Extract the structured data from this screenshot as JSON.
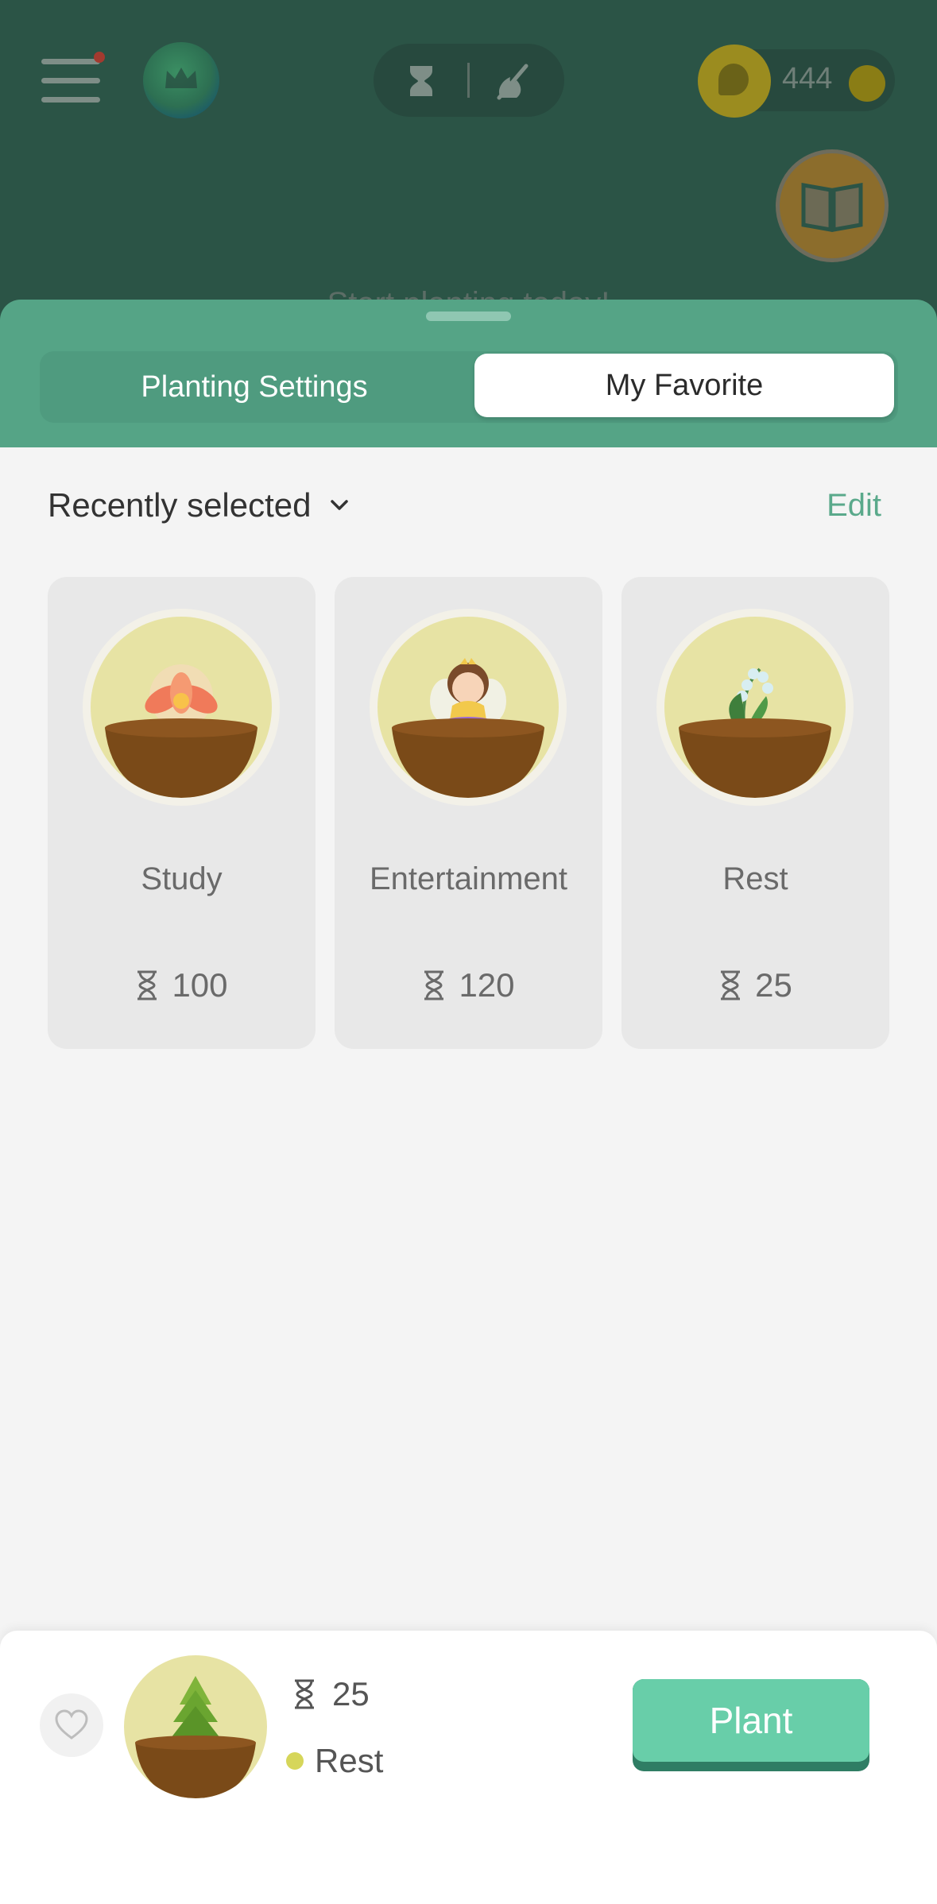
{
  "background": {
    "coins": "444",
    "peek_text": "Start planting today!"
  },
  "sheet": {
    "tabs": [
      {
        "label": "Planting Settings",
        "selected": false
      },
      {
        "label": "My Favorite",
        "selected": true
      }
    ],
    "section_title": "Recently selected",
    "edit_label": "Edit",
    "favorites": [
      {
        "name": "Study",
        "minutes": "100",
        "plant": "pink-flower"
      },
      {
        "name": "Entertainment",
        "minutes": "120",
        "plant": "fairy-girl"
      },
      {
        "name": "Rest",
        "minutes": "25",
        "plant": "lily-of-the-valley"
      }
    ]
  },
  "selection": {
    "minutes": "25",
    "tag": "Rest",
    "tag_color": "#d6d65a",
    "plant": "pine-tree",
    "plant_button": "Plant"
  },
  "colors": {
    "accent": "#55a486",
    "plant_button": "#68cea9"
  }
}
